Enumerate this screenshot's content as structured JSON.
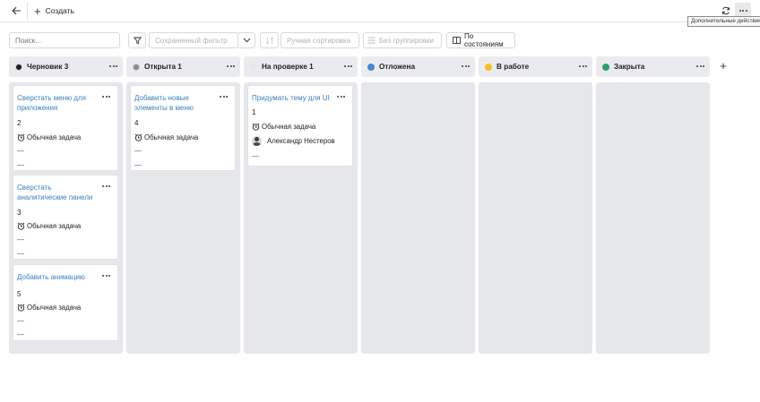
{
  "toolbar": {
    "back_icon": "arrow-left-icon",
    "create_label": "Создать",
    "refresh_icon": "refresh-icon",
    "more_icon": "more-dots-icon",
    "more_tooltip": "Дополнительные действия"
  },
  "filters": {
    "search_placeholder": "Поиск...",
    "filter_icon": "funnel-icon",
    "saved_filter_placeholder": "Сохраненный фильтр",
    "sort_icon": "sort-icon",
    "manual_sort_label": "Ручная сортировка",
    "grouping_label": "Без группировки",
    "by_states_label": "По состояниям"
  },
  "colors": {
    "draft": "#1f1f1f",
    "open": "#8c8c8c",
    "review": "#e6e7ea",
    "postponed": "#4a86c8",
    "in_progress": "#f2c12e",
    "closed": "#2e9e6b",
    "link": "#3a7fbf"
  },
  "columns": [
    {
      "title": "Черновик 3",
      "cards": [
        {
          "title": "Сверстать меню для приложения",
          "number": "2",
          "type": "Обычная задача",
          "line1": "—",
          "line2": "—"
        },
        {
          "title": "Сверстать аналитические панели",
          "number": "3",
          "type": "Обычная задача",
          "line1": "—",
          "line2": "—"
        },
        {
          "title": "Добавить анимацию",
          "number": "5",
          "type": "Обычная задача",
          "line1": "—",
          "line2": "—"
        }
      ]
    },
    {
      "title": "Открыта 1",
      "cards": [
        {
          "title": "Добавить новые элементы в меню",
          "number": "4",
          "type": "Обычная задача",
          "line1": "—",
          "line2": "—"
        }
      ]
    },
    {
      "title": "На проверке 1",
      "cards": [
        {
          "title": "Придумать тему для UI",
          "number": "1",
          "type": "Обычная задача",
          "assignee": "Александр Нестеров",
          "line2": "—"
        }
      ]
    },
    {
      "title": "Отложена",
      "cards": []
    },
    {
      "title": "В работе",
      "cards": []
    },
    {
      "title": "Закрыта",
      "cards": []
    }
  ]
}
